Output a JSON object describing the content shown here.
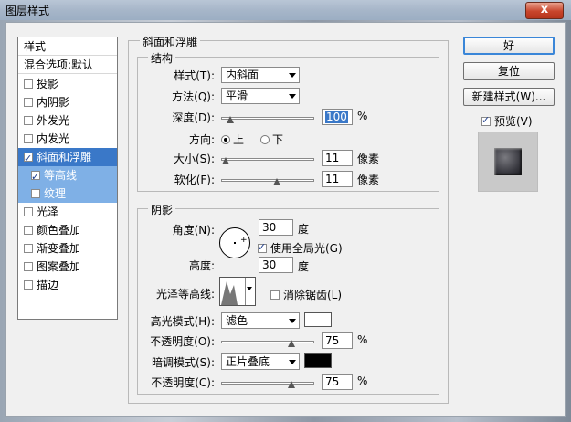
{
  "window": {
    "title": "图层样式",
    "close_glyph": "x"
  },
  "left_list": {
    "header": "样式",
    "blend_options": "混合选项:默认",
    "items": [
      {
        "label": "投影",
        "checked": false
      },
      {
        "label": "内阴影",
        "checked": false
      },
      {
        "label": "外发光",
        "checked": false
      },
      {
        "label": "内发光",
        "checked": false
      },
      {
        "label": "斜面和浮雕",
        "checked": true
      },
      {
        "label": "等高线",
        "checked": true
      },
      {
        "label": "纹理",
        "checked": false
      },
      {
        "label": "光泽",
        "checked": false
      },
      {
        "label": "颜色叠加",
        "checked": false
      },
      {
        "label": "渐变叠加",
        "checked": false
      },
      {
        "label": "图案叠加",
        "checked": false
      },
      {
        "label": "描边",
        "checked": false
      }
    ]
  },
  "bevel": {
    "title": "斜面和浮雕",
    "structure": {
      "title": "结构",
      "style_label": "样式(T):",
      "style_value": "内斜面",
      "technique_label": "方法(Q):",
      "technique_value": "平滑",
      "depth_label": "深度(D):",
      "depth_value": "100",
      "depth_unit": "%",
      "depth_slider": 0.1,
      "direction_label": "方向:",
      "direction_up": "上",
      "direction_down": "下",
      "size_label": "大小(S):",
      "size_value": "11",
      "size_unit": "像素",
      "size_slider": 0.05,
      "soften_label": "软化(F):",
      "soften_value": "11",
      "soften_unit": "像素",
      "soften_slider": 0.6
    },
    "shading": {
      "title": "阴影",
      "angle_label": "角度(N):",
      "angle_value": "30",
      "angle_unit": "度",
      "global_light_label": "使用全局光(G)",
      "altitude_label": "高度:",
      "altitude_value": "30",
      "altitude_unit": "度",
      "gloss_contour_label": "光泽等高线:",
      "anti_alias_label": "消除锯齿(L)",
      "highlight_mode_label": "高光模式(H):",
      "highlight_mode_value": "滤色",
      "highlight_color": "#ffffff",
      "highlight_opacity_label": "不透明度(O):",
      "highlight_opacity_value": "75",
      "highlight_opacity_unit": "%",
      "highlight_opacity_slider": 0.75,
      "shadow_mode_label": "暗调模式(S):",
      "shadow_mode_value": "正片叠底",
      "shadow_color": "#000000",
      "shadow_opacity_label": "不透明度(C):",
      "shadow_opacity_value": "75",
      "shadow_opacity_unit": "%",
      "shadow_opacity_slider": 0.75
    }
  },
  "buttons": {
    "ok": "好",
    "reset": "复位",
    "new_style": "新建样式(W)...",
    "preview": "预览(V)"
  }
}
